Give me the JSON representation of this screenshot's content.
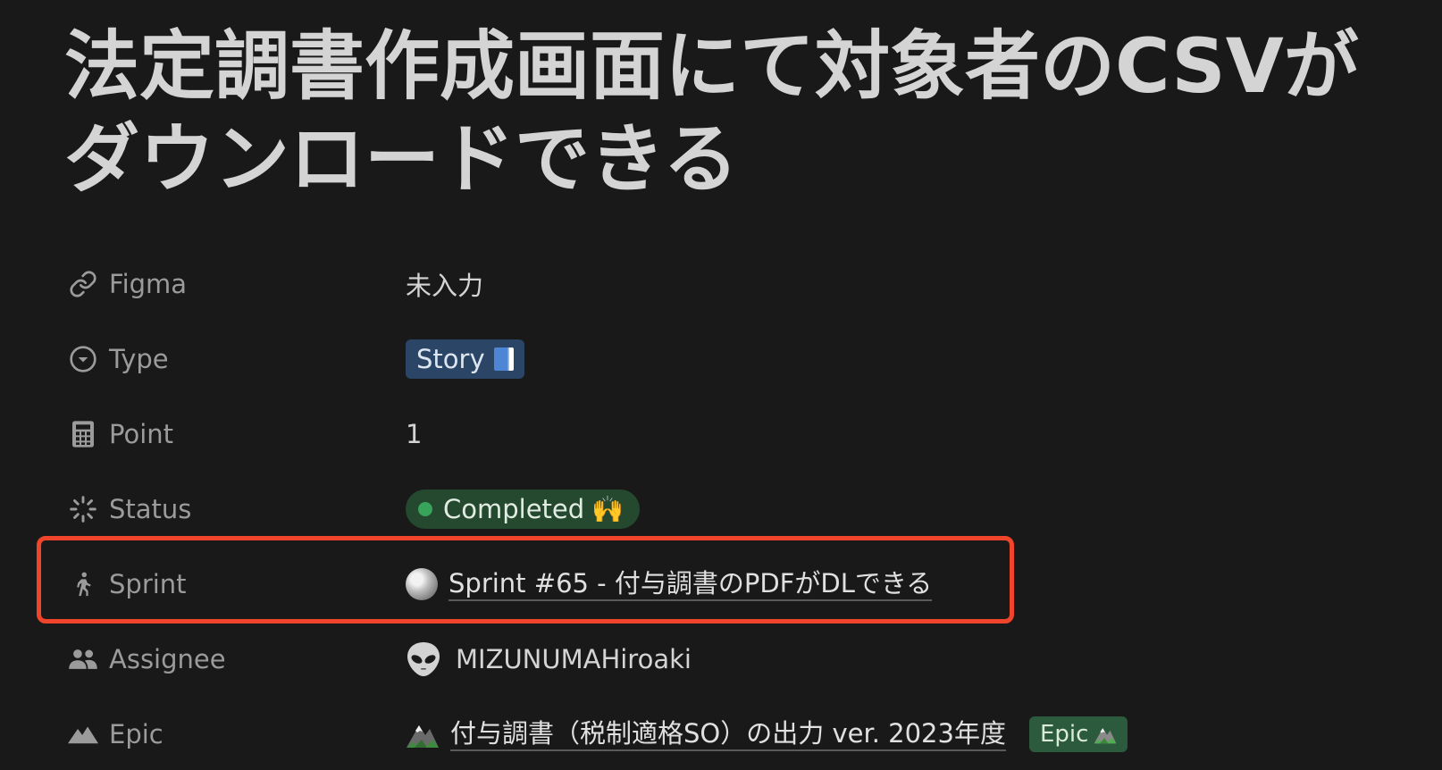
{
  "page": {
    "title": "法定調書作成画面にて対象者のCSVがダウンロードできる"
  },
  "properties": [
    {
      "key": "figma",
      "label": "Figma",
      "icon": "link-icon",
      "value": "未入力"
    },
    {
      "key": "type",
      "label": "Type",
      "icon": "select-circle-icon",
      "value": "Story",
      "value_icon": "blue-book-emoji"
    },
    {
      "key": "point",
      "label": "Point",
      "icon": "calculator-icon",
      "value": "1"
    },
    {
      "key": "status",
      "label": "Status",
      "icon": "status-spinner-icon",
      "value": "Completed",
      "value_suffix": "🙌"
    },
    {
      "key": "sprint",
      "label": "Sprint",
      "icon": "walking-person-icon",
      "value": "Sprint #65 - 付与調書のPDFがDLできる",
      "value_icon": "full-moon-icon"
    },
    {
      "key": "assignee",
      "label": "Assignee",
      "icon": "people-icon",
      "value": "MIZUNUMAHiroaki",
      "value_icon": "alien-avatar"
    },
    {
      "key": "epic",
      "label": "Epic",
      "icon": "mountain-icon",
      "value": "付与調書（税制適格SO）の出力 ver. 2023年度",
      "value_icon": "mountain-emoji",
      "tag": "Epic"
    }
  ],
  "colors": {
    "background": "#191919",
    "highlight_border": "#f0452a",
    "status_green": "#38a35a",
    "type_blue": "#2a4566"
  }
}
